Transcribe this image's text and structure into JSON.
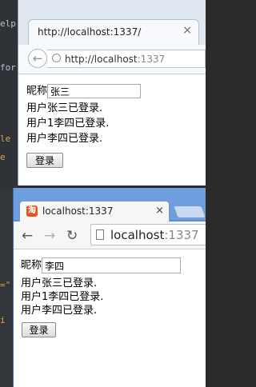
{
  "background_editor": {
    "fragments": [
      "elp",
      "for",
      "le",
      "e",
      "=\"",
      "i"
    ]
  },
  "window_back": {
    "tab_title": "http://localhost:1337/",
    "tab_close": "×",
    "url_host": "http://localhost",
    "url_port": ":1337",
    "nickname_label": "昵称",
    "nickname_value": "张三",
    "messages": [
      "用户张三已登录.",
      "用户1李四已登录.",
      "用户李四已登录."
    ],
    "login_button": "登录",
    "back_glyph": "←"
  },
  "window_front": {
    "favicon_glyph": "淘",
    "tab_title": "localhost:1337",
    "tab_close": "×",
    "url_host": "localhost",
    "url_port": ":1337",
    "nickname_label": "昵称",
    "nickname_value": "李四",
    "messages": [
      "用户张三已登录.",
      "用户1李四已登录.",
      "用户李四已登录."
    ],
    "login_button": "登录",
    "back_glyph": "←",
    "forward_glyph": "→",
    "reload_glyph": "↻"
  }
}
